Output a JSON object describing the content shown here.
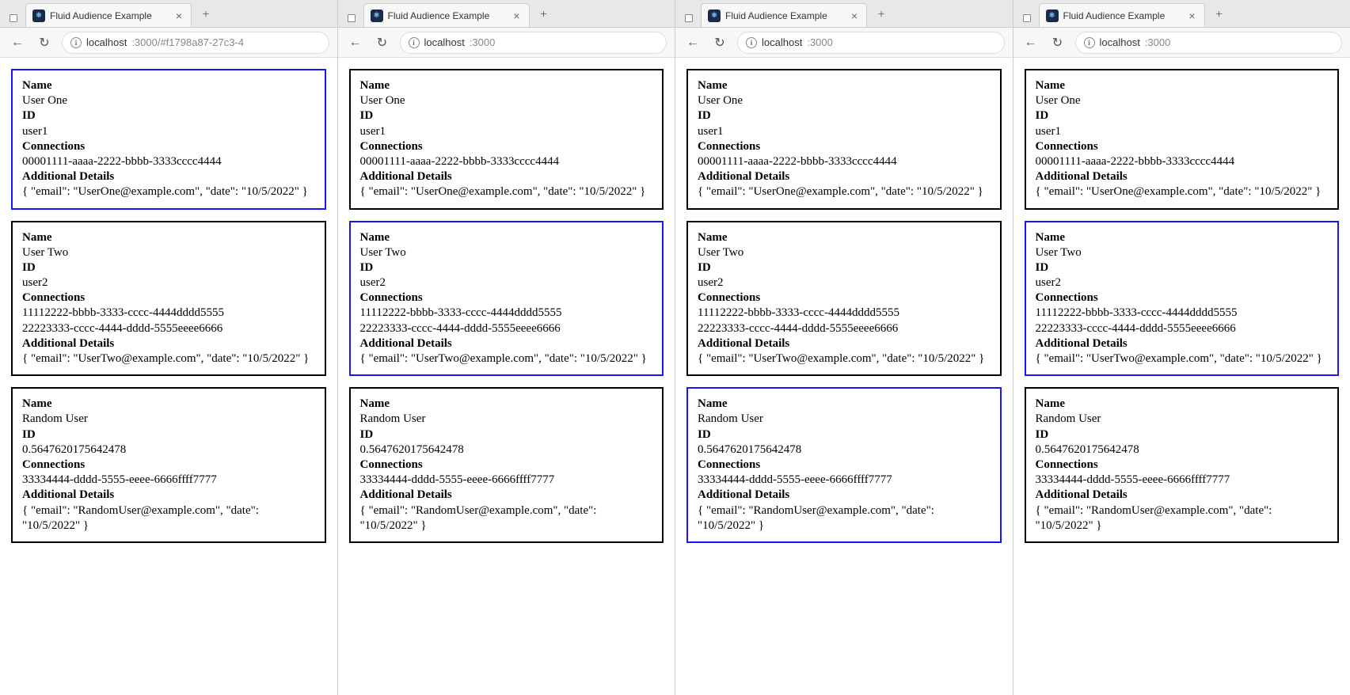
{
  "tabTitle": "Fluid Audience Example",
  "windows": [
    {
      "url_host": "localhost",
      "url_path": ":3000/#f1798a87-27c3-4",
      "selected_index": 0
    },
    {
      "url_host": "localhost",
      "url_path": ":3000",
      "selected_index": 1
    },
    {
      "url_host": "localhost",
      "url_path": ":3000",
      "selected_index": 2
    },
    {
      "url_host": "localhost",
      "url_path": ":3000",
      "selected_index": 1
    }
  ],
  "labels": {
    "name": "Name",
    "id": "ID",
    "connections": "Connections",
    "details": "Additional Details"
  },
  "users": [
    {
      "name": "User One",
      "id": "user1",
      "connections": [
        "00001111-aaaa-2222-bbbb-3333cccc4444"
      ],
      "details": "{ \"email\": \"UserOne@example.com\", \"date\": \"10/5/2022\" }"
    },
    {
      "name": "User Two",
      "id": "user2",
      "connections": [
        "11112222-bbbb-3333-cccc-4444dddd5555",
        "22223333-cccc-4444-dddd-5555eeee6666"
      ],
      "details": "{ \"email\": \"UserTwo@example.com\", \"date\": \"10/5/2022\" }"
    },
    {
      "name": "Random User",
      "id": "0.5647620175642478",
      "connections": [
        "33334444-dddd-5555-eeee-6666ffff7777"
      ],
      "details": "{ \"email\": \"RandomUser@example.com\", \"date\": \"10/5/2022\" }"
    }
  ]
}
